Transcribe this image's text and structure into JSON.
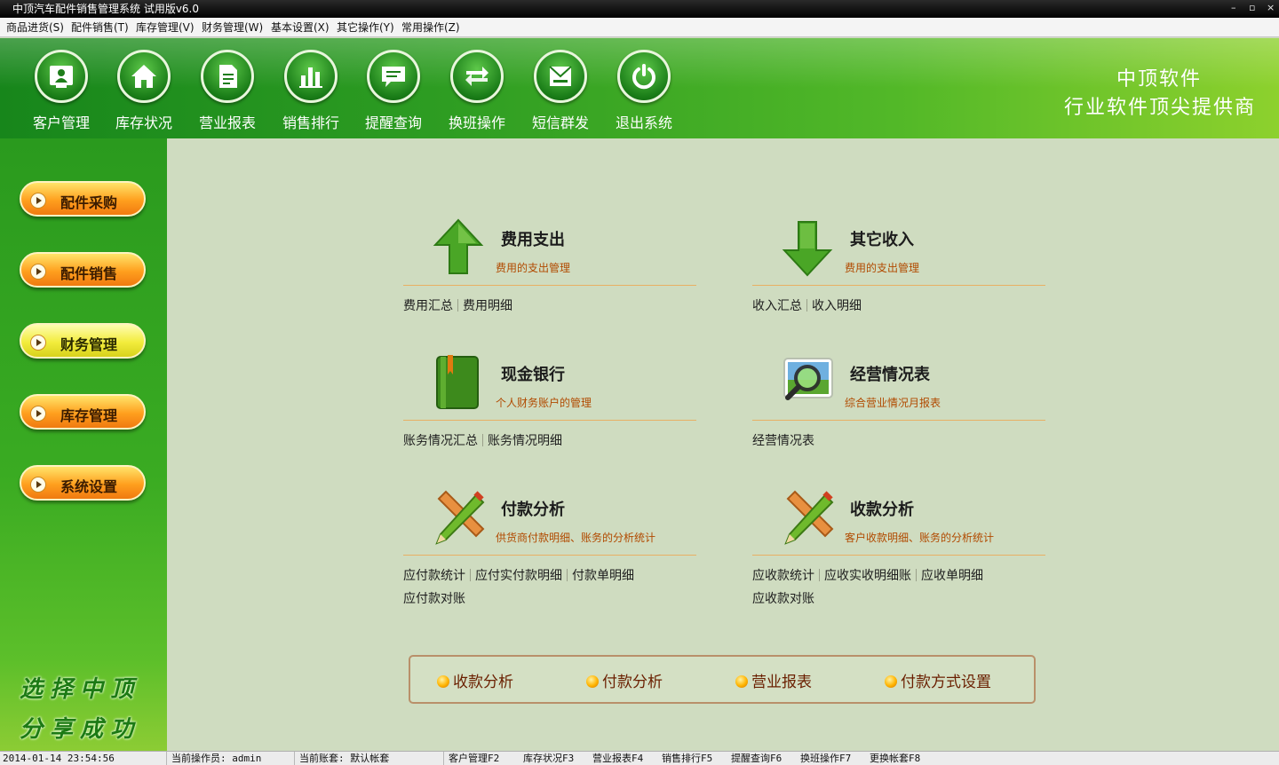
{
  "window": {
    "title": "中顶汽车配件销售管理系统 试用版v6.0",
    "minimize": "–",
    "restore": "▫",
    "close": "×"
  },
  "menu": [
    "商品进货(S)",
    "配件销售(T)",
    "库存管理(V)",
    "财务管理(W)",
    "基本设置(X)",
    "其它操作(Y)",
    "常用操作(Z)"
  ],
  "toolbar": [
    {
      "label": "客户管理",
      "icon": "customer-icon"
    },
    {
      "label": "库存状况",
      "icon": "home-icon"
    },
    {
      "label": "营业报表",
      "icon": "report-icon"
    },
    {
      "label": "销售排行",
      "icon": "bar-chart-icon"
    },
    {
      "label": "提醒查询",
      "icon": "message-icon"
    },
    {
      "label": "换班操作",
      "icon": "swap-icon"
    },
    {
      "label": "短信群发",
      "icon": "sms-icon"
    },
    {
      "label": "退出系统",
      "icon": "power-icon"
    }
  ],
  "brand": {
    "line1": "中顶软件",
    "line2": "行业软件顶尖提供商"
  },
  "sidebar": {
    "buttons": [
      "配件采购",
      "配件销售",
      "财务管理",
      "库存管理",
      "系统设置"
    ],
    "slogan1": "选择中顶",
    "slogan2": "分享成功"
  },
  "sections": {
    "expense": {
      "title": "费用支出",
      "subtitle": "费用的支出管理",
      "links": [
        "费用汇总",
        "费用明细"
      ]
    },
    "income": {
      "title": "其它收入",
      "subtitle": "费用的支出管理",
      "links": [
        "收入汇总",
        "收入明细"
      ]
    },
    "cash": {
      "title": "现金银行",
      "subtitle": "个人财务账户的管理",
      "links": [
        "账务情况汇总",
        "账务情况明细"
      ]
    },
    "business": {
      "title": "经营情况表",
      "subtitle": "综合营业情况月报表",
      "links": [
        "经营情况表"
      ]
    },
    "payment": {
      "title": "付款分析",
      "subtitle": "供货商付款明细、账务的分析统计",
      "links": [
        "应付款统计",
        "应付实付款明细",
        "付款单明细"
      ],
      "extra": "应付款对账"
    },
    "receipt": {
      "title": "收款分析",
      "subtitle": "客户收款明细、账务的分析统计",
      "links": [
        "应收款统计",
        "应收实收明细账",
        "应收单明细"
      ],
      "extra": "应收款对账"
    }
  },
  "quickbar": [
    "收款分析",
    "付款分析",
    "营业报表",
    "付款方式设置"
  ],
  "status": {
    "datetime": "2014-01-14 23:54:56",
    "operator": "当前操作员: admin",
    "account": "当前账套: 默认帐套",
    "shortcuts": [
      "客户管理F2",
      "库存状况F3",
      "营业报表F4",
      "销售排行F5",
      "提醒查询F6",
      "换班操作F7",
      "更换帐套F8"
    ]
  }
}
